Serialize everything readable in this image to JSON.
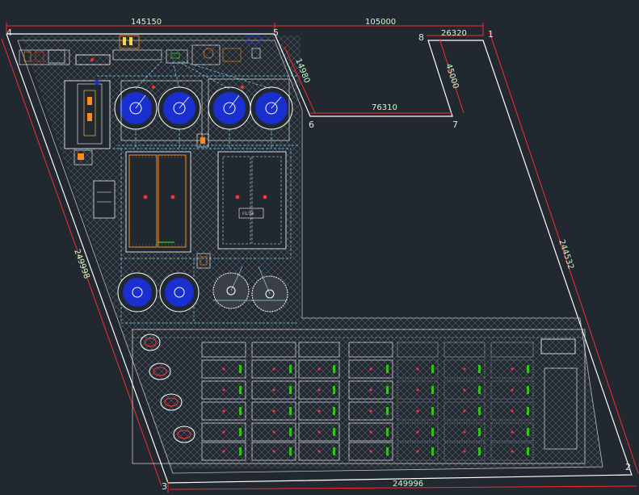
{
  "colors": {
    "background": "#212830",
    "boundary": "#ffffff",
    "dimension_line": "#ff2a2a",
    "dimension_text": "#c8ffc8",
    "vertex_label": "#e6e6e6",
    "hatch": "#6b7280",
    "tank_blue": "#1a2fd0",
    "pipe_cyan": "#7fd8ff",
    "accent_orange": "#ff8c1a",
    "accent_green": "#39ff14",
    "accent_red": "#ff3030"
  },
  "dimensions": {
    "top_left_span": "145150",
    "top_right_span": "105000",
    "notch_width": "26320",
    "notch_depth": "45000",
    "notch_bottom": "76310",
    "notch_step": "14980",
    "left_diagonal": "249998",
    "right_diagonal": "244532",
    "bottom_span": "249996"
  },
  "vertices": [
    "1",
    "2",
    "3",
    "4",
    "5",
    "6",
    "7",
    "8"
  ],
  "areas": {
    "thickener_label": "FILTER"
  }
}
